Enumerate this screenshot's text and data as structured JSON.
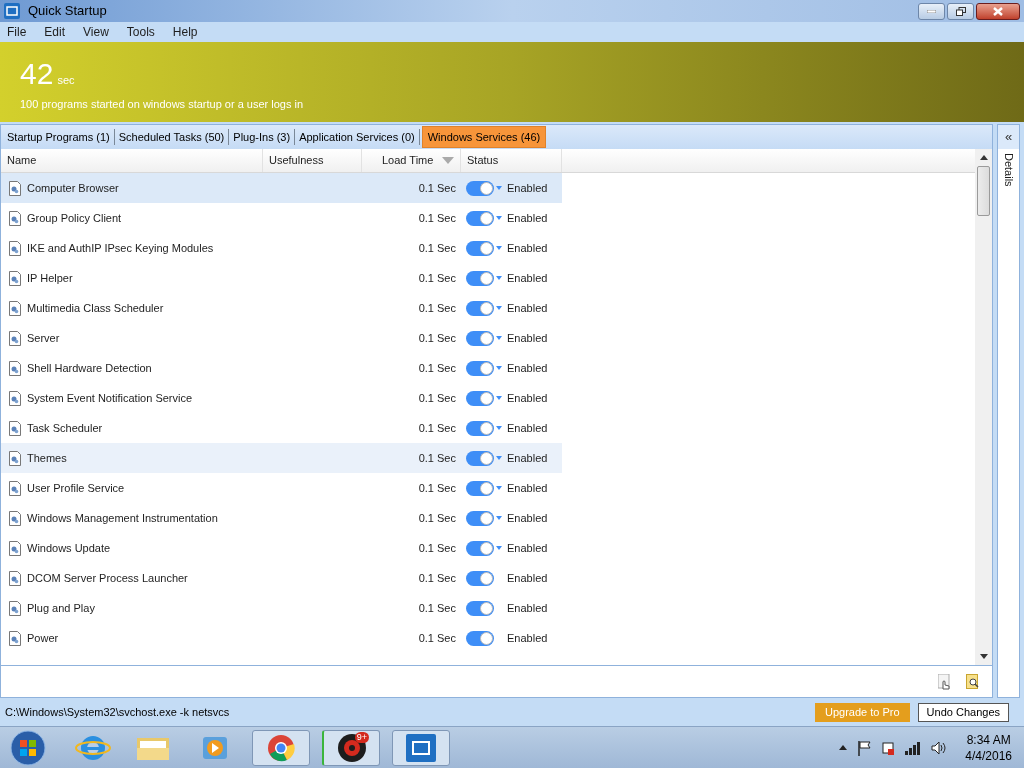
{
  "window": {
    "title": "Quick Startup"
  },
  "menu": [
    "File",
    "Edit",
    "View",
    "Tools",
    "Help"
  ],
  "banner": {
    "value": "42",
    "unit": "sec",
    "subtitle": "100 programs started on windows startup or a user logs in"
  },
  "tabs": [
    {
      "label": "Startup Programs (1)",
      "selected": false
    },
    {
      "label": "Scheduled Tasks (50)",
      "selected": false
    },
    {
      "label": "Plug-Ins (3)",
      "selected": false
    },
    {
      "label": "Application Services (0)",
      "selected": false
    },
    {
      "label": "Windows Services (46)",
      "selected": true
    }
  ],
  "table": {
    "columns": [
      "Name",
      "Usefulness",
      "Load Time",
      "Status"
    ],
    "rows": [
      {
        "name": "Computer Browser",
        "load_time": "0.1 Sec",
        "on": true,
        "dropdown": true,
        "status": "Enabled",
        "selected": true,
        "hovered": false
      },
      {
        "name": "Group Policy Client",
        "load_time": "0.1 Sec",
        "on": true,
        "dropdown": true,
        "status": "Enabled",
        "selected": false,
        "hovered": false
      },
      {
        "name": "IKE and AuthIP IPsec Keying Modules",
        "load_time": "0.1 Sec",
        "on": true,
        "dropdown": true,
        "status": "Enabled",
        "selected": false,
        "hovered": false
      },
      {
        "name": "IP Helper",
        "load_time": "0.1 Sec",
        "on": true,
        "dropdown": true,
        "status": "Enabled",
        "selected": false,
        "hovered": false
      },
      {
        "name": "Multimedia Class Scheduler",
        "load_time": "0.1 Sec",
        "on": true,
        "dropdown": true,
        "status": "Enabled",
        "selected": false,
        "hovered": false
      },
      {
        "name": "Server",
        "load_time": "0.1 Sec",
        "on": true,
        "dropdown": true,
        "status": "Enabled",
        "selected": false,
        "hovered": false
      },
      {
        "name": "Shell Hardware Detection",
        "load_time": "0.1 Sec",
        "on": true,
        "dropdown": true,
        "status": "Enabled",
        "selected": false,
        "hovered": false
      },
      {
        "name": "System Event Notification Service",
        "load_time": "0.1 Sec",
        "on": true,
        "dropdown": true,
        "status": "Enabled",
        "selected": false,
        "hovered": false
      },
      {
        "name": "Task Scheduler",
        "load_time": "0.1 Sec",
        "on": true,
        "dropdown": true,
        "status": "Enabled",
        "selected": false,
        "hovered": false
      },
      {
        "name": "Themes",
        "load_time": "0.1 Sec",
        "on": true,
        "dropdown": true,
        "status": "Enabled",
        "selected": false,
        "hovered": true
      },
      {
        "name": "User Profile Service",
        "load_time": "0.1 Sec",
        "on": true,
        "dropdown": true,
        "status": "Enabled",
        "selected": false,
        "hovered": false
      },
      {
        "name": "Windows Management Instrumentation",
        "load_time": "0.1 Sec",
        "on": true,
        "dropdown": true,
        "status": "Enabled",
        "selected": false,
        "hovered": false
      },
      {
        "name": "Windows Update",
        "load_time": "0.1 Sec",
        "on": true,
        "dropdown": true,
        "status": "Enabled",
        "selected": false,
        "hovered": false
      },
      {
        "name": "DCOM Server Process Launcher",
        "load_time": "0.1 Sec",
        "on": true,
        "dropdown": false,
        "status": "Enabled",
        "selected": false,
        "hovered": false
      },
      {
        "name": "Plug and Play",
        "load_time": "0.1 Sec",
        "on": true,
        "dropdown": false,
        "status": "Enabled",
        "selected": false,
        "hovered": false
      },
      {
        "name": "Power",
        "load_time": "0.1 Sec",
        "on": true,
        "dropdown": false,
        "status": "Enabled",
        "selected": false,
        "hovered": false
      }
    ]
  },
  "details_panel": {
    "label": "Details",
    "toggle": "«"
  },
  "status_bar": {
    "path": "C:\\Windows\\System32\\svchost.exe -k netsvcs",
    "buttons": [
      "Upgrade to Pro",
      "Undo Changes"
    ]
  },
  "taskbar": {
    "badge": "9+",
    "time": "8:34 AM",
    "date": "4/4/2016"
  }
}
